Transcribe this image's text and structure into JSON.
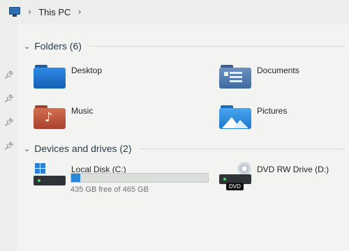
{
  "address": {
    "icon": "computer-icon",
    "crumbs": [
      "This PC"
    ]
  },
  "folders_group": {
    "title": "Folders (6)"
  },
  "folders": [
    {
      "name": "Desktop",
      "icon": "desktop-folder-icon",
      "color": "#1e7ad6"
    },
    {
      "name": "Documents",
      "icon": "documents-folder-icon",
      "color": "#4a73a8"
    },
    {
      "name": "Music",
      "icon": "music-folder-icon",
      "color": "#c2563c"
    },
    {
      "name": "Pictures",
      "icon": "pictures-folder-icon",
      "color": "#2a8ee0"
    }
  ],
  "devices_group": {
    "title": "Devices and drives (2)"
  },
  "drives": [
    {
      "name": "Local Disk (C:)",
      "icon": "local-disk-icon",
      "free_text": "435 GB free of 465 GB",
      "used_fraction": 0.065
    },
    {
      "name": "DVD RW Drive (D:)",
      "icon": "dvd-drive-icon",
      "badge": "DVD"
    }
  ]
}
